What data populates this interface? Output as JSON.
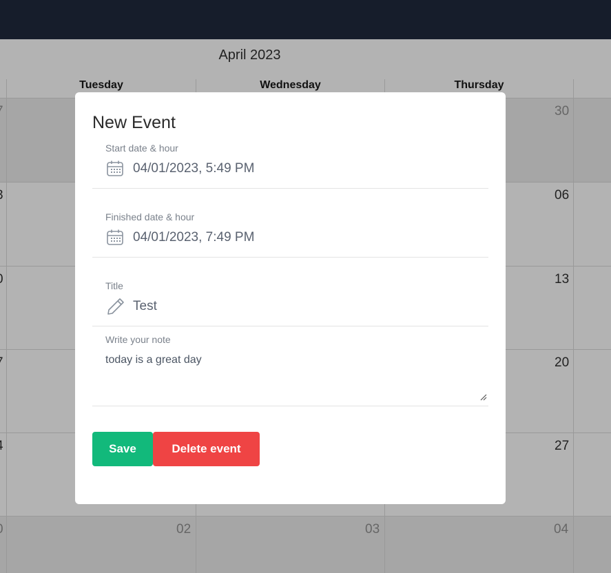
{
  "calendar": {
    "month": "April 2023",
    "weekdays": [
      "Tuesday",
      "Wednesday",
      "Thursday"
    ],
    "day_numbers": {
      "row1": [
        "7",
        "30"
      ],
      "row2": [
        "3",
        "06"
      ],
      "row3": [
        "0",
        "13"
      ],
      "row4": [
        "7",
        "20"
      ],
      "row5": [
        "4",
        "27"
      ],
      "row6": [
        "0",
        "02",
        "03",
        "04"
      ]
    }
  },
  "modal": {
    "title": "New Event",
    "start": {
      "label": "Start date & hour",
      "value": "04/01/2023, 5:49 PM",
      "icon": "calendar-icon"
    },
    "end": {
      "label": "Finished date & hour",
      "value": "04/01/2023, 7:49 PM",
      "icon": "calendar-icon"
    },
    "title_field": {
      "label": "Title",
      "value": "Test",
      "icon": "pencil-icon"
    },
    "note": {
      "label": "Write your note",
      "value": "today is a great day"
    },
    "buttons": {
      "save": "Save",
      "delete": "Delete event"
    },
    "colors": {
      "save": "#12b97b",
      "delete": "#ef4444"
    }
  }
}
